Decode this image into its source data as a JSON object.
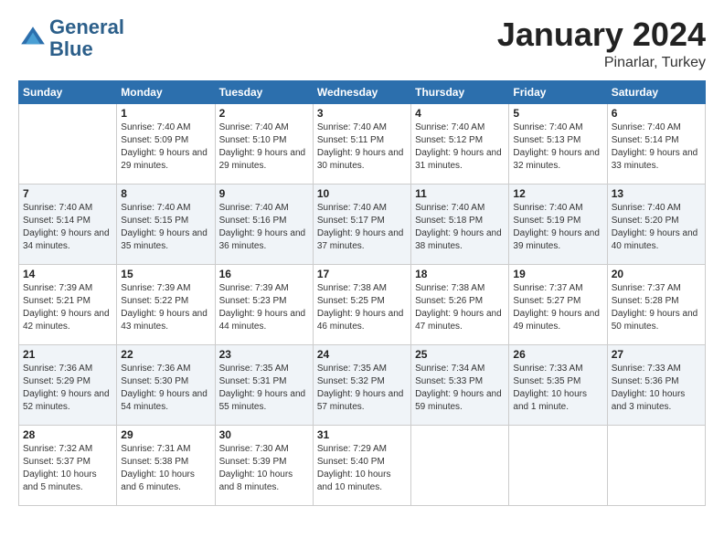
{
  "header": {
    "logo_line1": "General",
    "logo_line2": "Blue",
    "month": "January 2024",
    "location": "Pinarlar, Turkey"
  },
  "weekdays": [
    "Sunday",
    "Monday",
    "Tuesday",
    "Wednesday",
    "Thursday",
    "Friday",
    "Saturday"
  ],
  "weeks": [
    [
      {
        "day": "",
        "sunrise": "",
        "sunset": "",
        "daylight": ""
      },
      {
        "day": "1",
        "sunrise": "Sunrise: 7:40 AM",
        "sunset": "Sunset: 5:09 PM",
        "daylight": "Daylight: 9 hours and 29 minutes."
      },
      {
        "day": "2",
        "sunrise": "Sunrise: 7:40 AM",
        "sunset": "Sunset: 5:10 PM",
        "daylight": "Daylight: 9 hours and 29 minutes."
      },
      {
        "day": "3",
        "sunrise": "Sunrise: 7:40 AM",
        "sunset": "Sunset: 5:11 PM",
        "daylight": "Daylight: 9 hours and 30 minutes."
      },
      {
        "day": "4",
        "sunrise": "Sunrise: 7:40 AM",
        "sunset": "Sunset: 5:12 PM",
        "daylight": "Daylight: 9 hours and 31 minutes."
      },
      {
        "day": "5",
        "sunrise": "Sunrise: 7:40 AM",
        "sunset": "Sunset: 5:13 PM",
        "daylight": "Daylight: 9 hours and 32 minutes."
      },
      {
        "day": "6",
        "sunrise": "Sunrise: 7:40 AM",
        "sunset": "Sunset: 5:14 PM",
        "daylight": "Daylight: 9 hours and 33 minutes."
      }
    ],
    [
      {
        "day": "7",
        "sunrise": "Sunrise: 7:40 AM",
        "sunset": "Sunset: 5:14 PM",
        "daylight": "Daylight: 9 hours and 34 minutes."
      },
      {
        "day": "8",
        "sunrise": "Sunrise: 7:40 AM",
        "sunset": "Sunset: 5:15 PM",
        "daylight": "Daylight: 9 hours and 35 minutes."
      },
      {
        "day": "9",
        "sunrise": "Sunrise: 7:40 AM",
        "sunset": "Sunset: 5:16 PM",
        "daylight": "Daylight: 9 hours and 36 minutes."
      },
      {
        "day": "10",
        "sunrise": "Sunrise: 7:40 AM",
        "sunset": "Sunset: 5:17 PM",
        "daylight": "Daylight: 9 hours and 37 minutes."
      },
      {
        "day": "11",
        "sunrise": "Sunrise: 7:40 AM",
        "sunset": "Sunset: 5:18 PM",
        "daylight": "Daylight: 9 hours and 38 minutes."
      },
      {
        "day": "12",
        "sunrise": "Sunrise: 7:40 AM",
        "sunset": "Sunset: 5:19 PM",
        "daylight": "Daylight: 9 hours and 39 minutes."
      },
      {
        "day": "13",
        "sunrise": "Sunrise: 7:40 AM",
        "sunset": "Sunset: 5:20 PM",
        "daylight": "Daylight: 9 hours and 40 minutes."
      }
    ],
    [
      {
        "day": "14",
        "sunrise": "Sunrise: 7:39 AM",
        "sunset": "Sunset: 5:21 PM",
        "daylight": "Daylight: 9 hours and 42 minutes."
      },
      {
        "day": "15",
        "sunrise": "Sunrise: 7:39 AM",
        "sunset": "Sunset: 5:22 PM",
        "daylight": "Daylight: 9 hours and 43 minutes."
      },
      {
        "day": "16",
        "sunrise": "Sunrise: 7:39 AM",
        "sunset": "Sunset: 5:23 PM",
        "daylight": "Daylight: 9 hours and 44 minutes."
      },
      {
        "day": "17",
        "sunrise": "Sunrise: 7:38 AM",
        "sunset": "Sunset: 5:25 PM",
        "daylight": "Daylight: 9 hours and 46 minutes."
      },
      {
        "day": "18",
        "sunrise": "Sunrise: 7:38 AM",
        "sunset": "Sunset: 5:26 PM",
        "daylight": "Daylight: 9 hours and 47 minutes."
      },
      {
        "day": "19",
        "sunrise": "Sunrise: 7:37 AM",
        "sunset": "Sunset: 5:27 PM",
        "daylight": "Daylight: 9 hours and 49 minutes."
      },
      {
        "day": "20",
        "sunrise": "Sunrise: 7:37 AM",
        "sunset": "Sunset: 5:28 PM",
        "daylight": "Daylight: 9 hours and 50 minutes."
      }
    ],
    [
      {
        "day": "21",
        "sunrise": "Sunrise: 7:36 AM",
        "sunset": "Sunset: 5:29 PM",
        "daylight": "Daylight: 9 hours and 52 minutes."
      },
      {
        "day": "22",
        "sunrise": "Sunrise: 7:36 AM",
        "sunset": "Sunset: 5:30 PM",
        "daylight": "Daylight: 9 hours and 54 minutes."
      },
      {
        "day": "23",
        "sunrise": "Sunrise: 7:35 AM",
        "sunset": "Sunset: 5:31 PM",
        "daylight": "Daylight: 9 hours and 55 minutes."
      },
      {
        "day": "24",
        "sunrise": "Sunrise: 7:35 AM",
        "sunset": "Sunset: 5:32 PM",
        "daylight": "Daylight: 9 hours and 57 minutes."
      },
      {
        "day": "25",
        "sunrise": "Sunrise: 7:34 AM",
        "sunset": "Sunset: 5:33 PM",
        "daylight": "Daylight: 9 hours and 59 minutes."
      },
      {
        "day": "26",
        "sunrise": "Sunrise: 7:33 AM",
        "sunset": "Sunset: 5:35 PM",
        "daylight": "Daylight: 10 hours and 1 minute."
      },
      {
        "day": "27",
        "sunrise": "Sunrise: 7:33 AM",
        "sunset": "Sunset: 5:36 PM",
        "daylight": "Daylight: 10 hours and 3 minutes."
      }
    ],
    [
      {
        "day": "28",
        "sunrise": "Sunrise: 7:32 AM",
        "sunset": "Sunset: 5:37 PM",
        "daylight": "Daylight: 10 hours and 5 minutes."
      },
      {
        "day": "29",
        "sunrise": "Sunrise: 7:31 AM",
        "sunset": "Sunset: 5:38 PM",
        "daylight": "Daylight: 10 hours and 6 minutes."
      },
      {
        "day": "30",
        "sunrise": "Sunrise: 7:30 AM",
        "sunset": "Sunset: 5:39 PM",
        "daylight": "Daylight: 10 hours and 8 minutes."
      },
      {
        "day": "31",
        "sunrise": "Sunrise: 7:29 AM",
        "sunset": "Sunset: 5:40 PM",
        "daylight": "Daylight: 10 hours and 10 minutes."
      },
      {
        "day": "",
        "sunrise": "",
        "sunset": "",
        "daylight": ""
      },
      {
        "day": "",
        "sunrise": "",
        "sunset": "",
        "daylight": ""
      },
      {
        "day": "",
        "sunrise": "",
        "sunset": "",
        "daylight": ""
      }
    ]
  ]
}
